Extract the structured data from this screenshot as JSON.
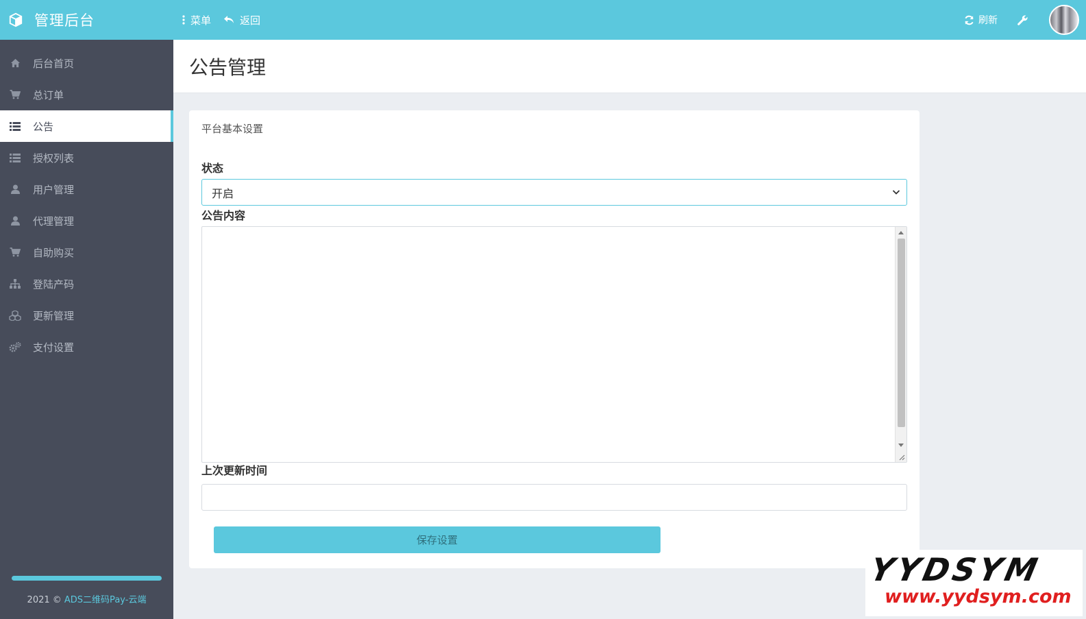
{
  "brand": {
    "title": "管理后台"
  },
  "topbar": {
    "menu_label": "菜单",
    "back_label": "返回",
    "refresh_label": "刷新"
  },
  "sidebar": {
    "items": [
      {
        "label": "后台首页",
        "icon": "home-icon"
      },
      {
        "label": "总订单",
        "icon": "cart-icon"
      },
      {
        "label": "公告",
        "icon": "list-icon",
        "active": true
      },
      {
        "label": "授权列表",
        "icon": "list-icon"
      },
      {
        "label": "用户管理",
        "icon": "user-icon"
      },
      {
        "label": "代理管理",
        "icon": "user-icon"
      },
      {
        "label": "自助购买",
        "icon": "cart-icon"
      },
      {
        "label": "登陆产码",
        "icon": "sitemap-icon"
      },
      {
        "label": "更新管理",
        "icon": "cubes-icon"
      },
      {
        "label": "支付设置",
        "icon": "gears-icon"
      }
    ],
    "footer_prefix": "2021 © ",
    "footer_link": "ADS二维码Pay-云端"
  },
  "page": {
    "title": "公告管理"
  },
  "card": {
    "title": "平台基本设置",
    "status_label": "状态",
    "status_value": "开启",
    "content_label": "公告内容",
    "content_value": "",
    "updated_label": "上次更新时间",
    "updated_value": "",
    "save_label": "保存设置"
  },
  "watermark": {
    "brand": "YYDSYM",
    "url": "www.yydsym.com"
  },
  "colors": {
    "accent": "#5bc8dd",
    "sidebar": "#474c5a",
    "background": "#ebeef2"
  }
}
